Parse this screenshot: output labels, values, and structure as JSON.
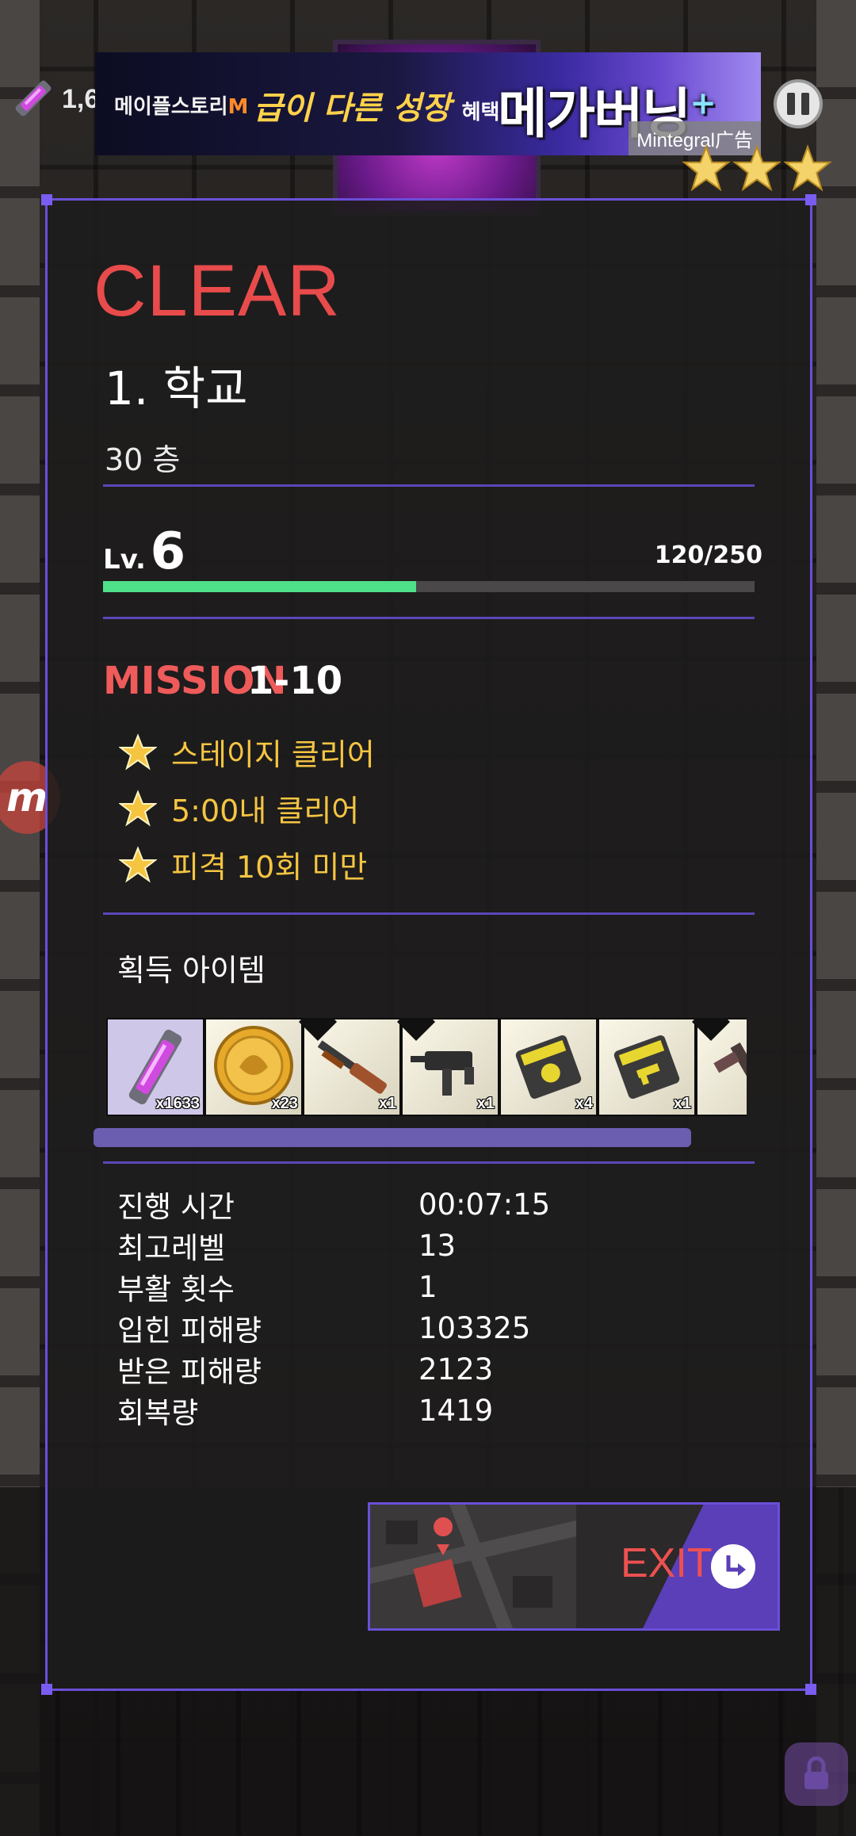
{
  "hud": {
    "crystal_count": "1,6",
    "crystal_icon": "crystal-icon"
  },
  "ad": {
    "brand_prefix": "메이플스토리",
    "brand_suffix": "M",
    "slogan": "급이 다른 성장",
    "slogan_suffix": "혜택",
    "headline": "메가버닝",
    "headline_plus": "+",
    "label": "Mintegral广告"
  },
  "result": {
    "title": "CLEAR",
    "stage_name": "1. 학교",
    "floor": "30 층",
    "level_prefix": "Lv.",
    "level": "6",
    "exp_text": "120/250",
    "exp_fraction": 0.48,
    "mission_label": "MISSION",
    "mission_number": "1-10",
    "missions": [
      {
        "label": "스테이지 클리어"
      },
      {
        "label": "5:00내 클리어"
      },
      {
        "label": "피격 10회 미만"
      }
    ],
    "items_label": "획득 아이템",
    "items": [
      {
        "icon": "crystal-icon",
        "qty": "x1633"
      },
      {
        "icon": "gold-coin-icon",
        "qty": "x23"
      },
      {
        "icon": "shotgun-icon",
        "qty": "x1"
      },
      {
        "icon": "smg-icon",
        "qty": "x1"
      },
      {
        "icon": "paw-ammo-icon",
        "qty": "x4"
      },
      {
        "icon": "gun-ammo-icon",
        "qty": "x1"
      },
      {
        "icon": "pistol-icon",
        "qty": ""
      }
    ],
    "stats": [
      {
        "label": "진행 시간",
        "value": "00:07:15"
      },
      {
        "label": "최고레벨",
        "value": "13"
      },
      {
        "label": "부활 횟수",
        "value": "1"
      },
      {
        "label": "입힌 피해량",
        "value": "103325"
      },
      {
        "label": "받은 피해량",
        "value": "2123"
      },
      {
        "label": "회복량",
        "value": "1419"
      }
    ],
    "exit_label": "EXIT"
  },
  "side_button": {
    "label": "m"
  },
  "colors": {
    "accent": "#6a4fd8",
    "clear_red": "#e84b4b",
    "exp_green": "#4fe08a",
    "mission_yellow": "#f5c542"
  }
}
